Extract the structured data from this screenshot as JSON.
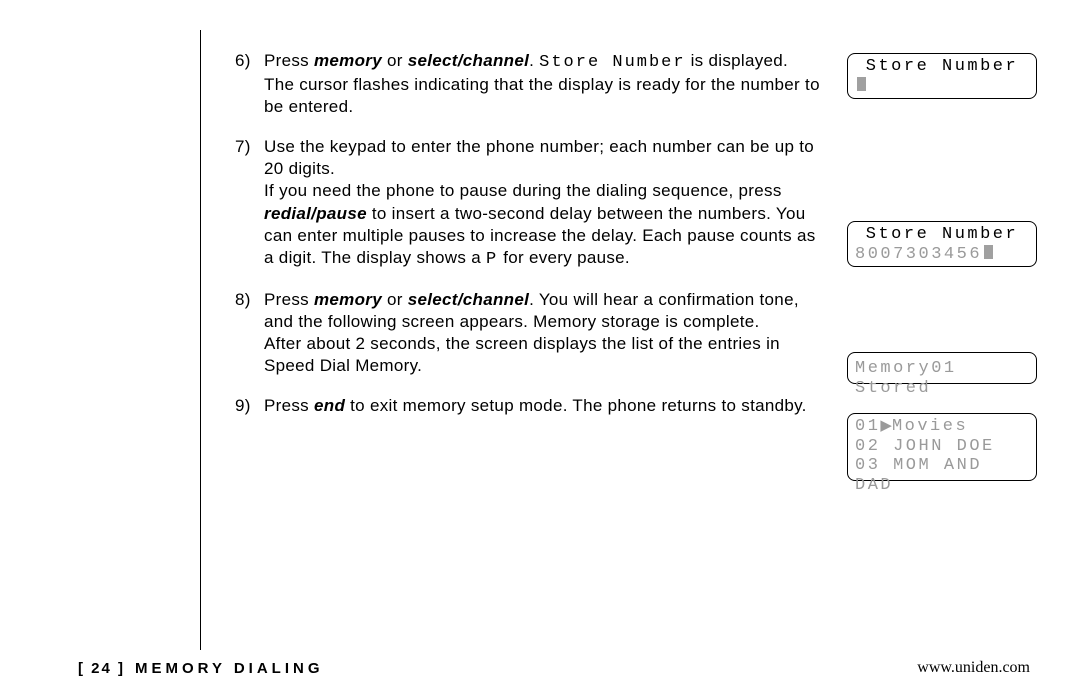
{
  "steps": {
    "s6": {
      "num": "6)",
      "pre": "Press ",
      "b1": "memory",
      "mid1": " or ",
      "b2": "select/channel",
      "post1": ". ",
      "lcd": "Store Number",
      "post2": " is displayed.",
      "para2": "The cursor flashes indicating that the display is ready for the number to be entered."
    },
    "s7": {
      "num": "7)",
      "p1": "Use the keypad to enter the phone number; each number can be up to 20 digits.",
      "p2a": "If you need the phone to pause during the dialing sequence, press ",
      "b1": "redial/pause",
      "p2b": " to insert a two-second delay between the numbers. You can enter multiple pauses to increase the delay. Each pause counts as a digit. The display shows a ",
      "lcd": "P",
      "p2c": " for every pause."
    },
    "s8": {
      "num": "8)",
      "pre": "Press ",
      "b1": "memory",
      "mid1": " or ",
      "b2": "select/channel",
      "post1": ". You will hear a confirmation tone, and the following screen appears. Memory storage is complete.",
      "para2": "After about 2 seconds, the screen displays the list of the entries in Speed Dial Memory."
    },
    "s9": {
      "num": "9)",
      "pre": "Press ",
      "b1": "end",
      "post": " to exit memory setup mode. The phone returns to standby."
    }
  },
  "lcd": {
    "box1": {
      "line1": "Store Number"
    },
    "box2": {
      "line1": "Store Number",
      "line2": "8007303456"
    },
    "box3": {
      "line1": "Memory01 Stored"
    },
    "box4": {
      "line1_num": "01",
      "line1_name": "Movies",
      "line2": "02 JOHN DOE",
      "line3": "03 MOM AND DAD"
    }
  },
  "footer": {
    "page": "[ 24 ]",
    "section": "MEMORY DIALING",
    "url": "www.uniden.com"
  }
}
